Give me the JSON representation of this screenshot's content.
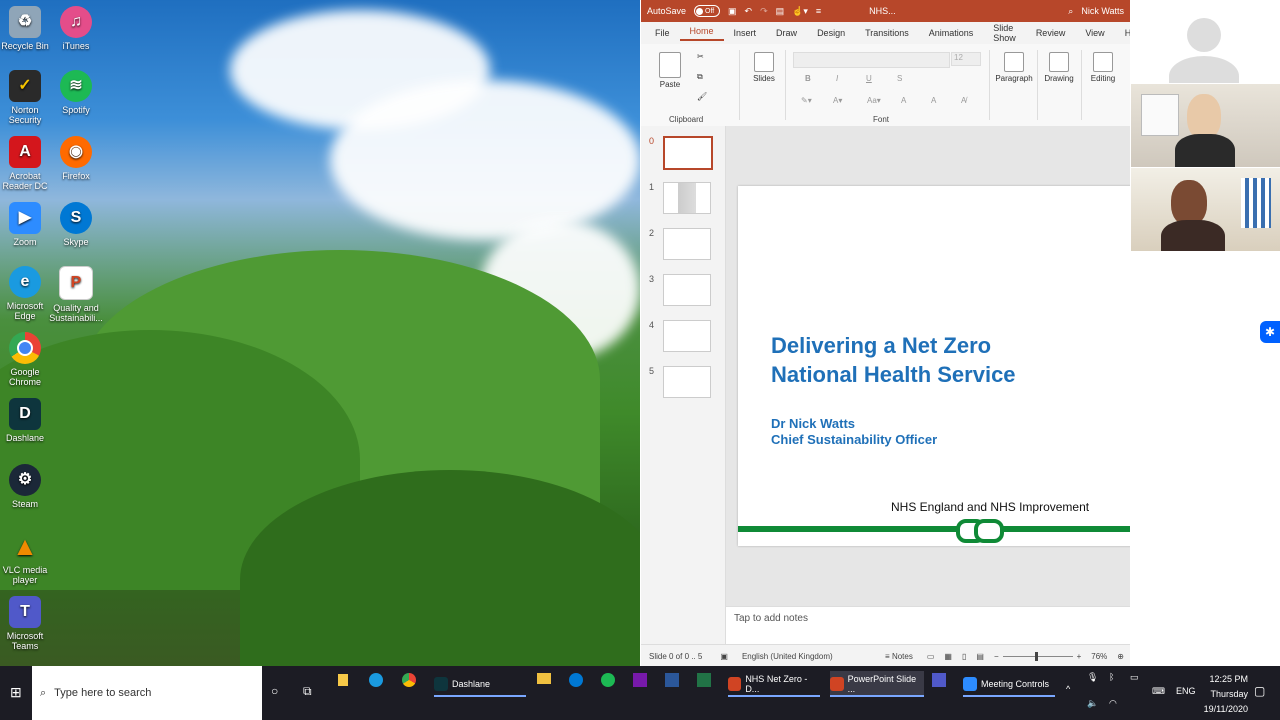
{
  "desktop": {
    "icons": [
      {
        "label": "Recycle Bin",
        "icon": "recycle-bin-icon",
        "color": "#8fa5b8"
      },
      {
        "label": "iTunes",
        "icon": "itunes-icon",
        "color": "#e44d8a"
      },
      {
        "label": "Norton Security",
        "icon": "norton-icon",
        "color": "#f5c400"
      },
      {
        "label": "Spotify",
        "icon": "spotify-icon",
        "color": "#1db954"
      },
      {
        "label": "Acrobat Reader DC",
        "icon": "acrobat-icon",
        "color": "#d4161c"
      },
      {
        "label": "Firefox",
        "icon": "firefox-icon",
        "color": "#ff6a00"
      },
      {
        "label": "Zoom",
        "icon": "zoom-icon",
        "color": "#2d8cff"
      },
      {
        "label": "Skype",
        "icon": "skype-icon",
        "color": "#0078d4"
      },
      {
        "label": "Microsoft Edge",
        "icon": "edge-icon",
        "color": "#1a9ae0"
      },
      {
        "label": "Quality and Sustainabili...",
        "icon": "document-icon",
        "color": "#d04423"
      },
      {
        "label": "Google Chrome",
        "icon": "chrome-icon",
        "color": "#4285f4"
      },
      {
        "label": "Dashlane",
        "icon": "dashlane-icon",
        "color": "#0e353d"
      },
      {
        "label": "Steam",
        "icon": "steam-icon",
        "color": "#1b2838"
      },
      {
        "label": "VLC media player",
        "icon": "vlc-icon",
        "color": "#f08a00"
      },
      {
        "label": "Microsoft Teams",
        "icon": "teams-icon",
        "color": "#5059c9"
      }
    ]
  },
  "ppt": {
    "titlebar": {
      "autosave": "AutoSave",
      "toggle": "Off",
      "filename": "NHS...",
      "user": "Nick Watts"
    },
    "tabs": [
      "File",
      "Home",
      "Insert",
      "Draw",
      "Design",
      "Transitions",
      "Animations",
      "Slide Show",
      "Review",
      "View",
      "He"
    ],
    "active_tab": "Home",
    "ribbon": {
      "paste": "Paste",
      "clipboard": "Clipboard",
      "slides": "Slides",
      "font_size": "12",
      "font": "Font",
      "paragraph": "Paragraph",
      "drawing": "Drawing",
      "editing": "Editing",
      "bold": "B",
      "italic": "I",
      "underline": "U",
      "strike": "S"
    },
    "thumbnails": [
      "0",
      "1",
      "2",
      "3",
      "4",
      "5"
    ],
    "slide": {
      "title_line1": "Delivering a Net Zero",
      "title_line2": "National Health Service",
      "author": "Dr Nick Watts",
      "role": "Chief Sustainability Officer",
      "org": "NHS England and NHS Improvement"
    },
    "notes_placeholder": "Tap to add notes",
    "status": {
      "slide": "Slide 0 of 0 .. 5",
      "language": "English (United Kingdom)",
      "notes": "Notes",
      "zoom": "76%"
    }
  },
  "taskbar": {
    "search_placeholder": "Type here to search",
    "items": [
      "Dashlane",
      "NHS Net Zero - D...",
      "PowerPoint Slide ...",
      "Meeting Controls"
    ],
    "lang": "ENG",
    "time": "12:25 PM",
    "day": "Thursday",
    "date": "19/11/2020"
  }
}
